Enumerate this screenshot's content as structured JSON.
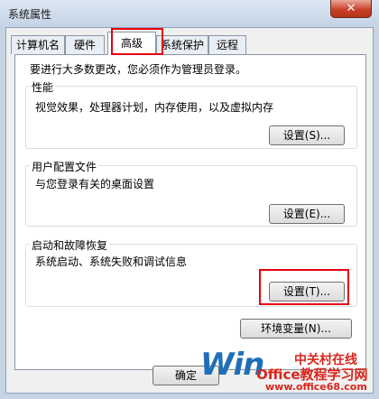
{
  "window": {
    "title": "系统属性",
    "close_glyph": "✕"
  },
  "tabs": [
    {
      "label": "计算机名",
      "active": false
    },
    {
      "label": "硬件",
      "active": false
    },
    {
      "label": "高级",
      "active": true
    },
    {
      "label": "系统保护",
      "active": false
    },
    {
      "label": "远程",
      "active": false
    }
  ],
  "advanced": {
    "intro": "要进行大多数更改，您必须作为管理员登录。",
    "performance": {
      "title": "性能",
      "description": "视觉效果，处理器计划，内存使用，以及虚拟内存",
      "button": "设置(S)..."
    },
    "user_profiles": {
      "title": "用户配置文件",
      "description": "与您登录有关的桌面设置",
      "button": "设置(E)..."
    },
    "startup_recovery": {
      "title": "启动和故障恢复",
      "description": "系统启动、系统失败和调试信息",
      "button": "设置(T)..."
    },
    "env_button": "环境变量(N)..."
  },
  "footer": {
    "ok_button": "确定"
  },
  "watermark": {
    "brand": "Win",
    "red_text": "中关村在线",
    "office_text": "Office教程学习网",
    "url": "www.office68.com"
  },
  "highlight_color": "#e60012"
}
